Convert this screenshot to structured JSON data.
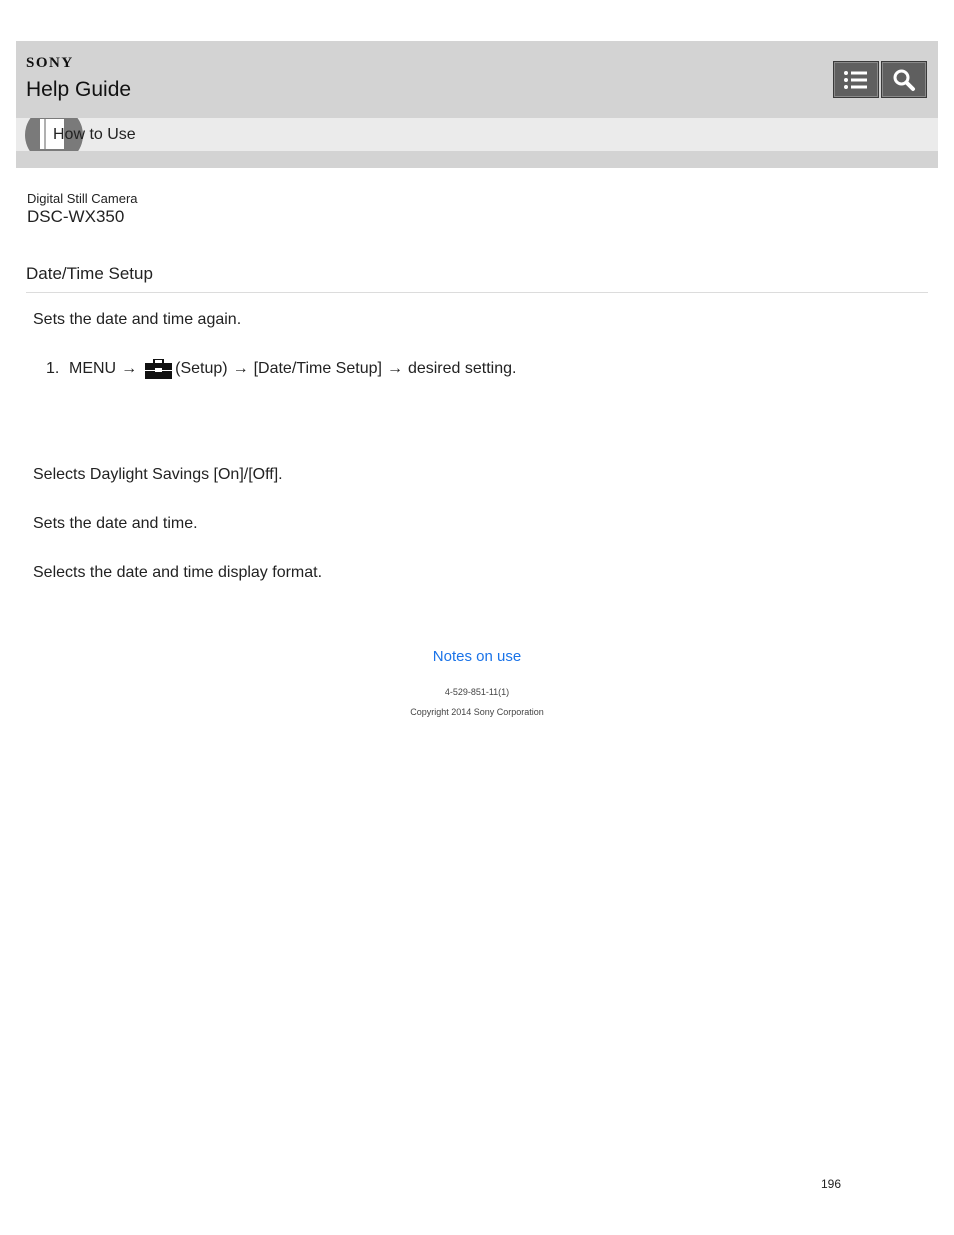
{
  "header": {
    "brand": "SONY",
    "title": "Help Guide",
    "nav_label": "How to Use"
  },
  "product": {
    "category": "Digital Still Camera",
    "model": "DSC-WX350"
  },
  "page": {
    "title": "Date/Time Setup",
    "intro": "Sets the date and time again.",
    "step": {
      "number": "1.",
      "menu": "MENU",
      "arrow": "→",
      "setup_label": "(Setup)",
      "item": "[Date/Time Setup]",
      "end": "desired setting."
    },
    "items": [
      "Selects Daylight Savings [On]/[Off].",
      "Sets the date and time.",
      "Selects the date and time display format."
    ]
  },
  "footer": {
    "link": "Notes on use",
    "doc_id": "4-529-851-11(1)",
    "copyright": "Copyright 2014 Sony Corporation",
    "page_number": "196"
  },
  "colors": {
    "header_bg": "#d3d3d3",
    "nav_strip_bg": "#ebebeb",
    "button_bg": "#5f5f5f",
    "link": "#1a73e8"
  },
  "icons": [
    "list-icon",
    "search-icon",
    "book-icon",
    "toolbox-icon"
  ]
}
